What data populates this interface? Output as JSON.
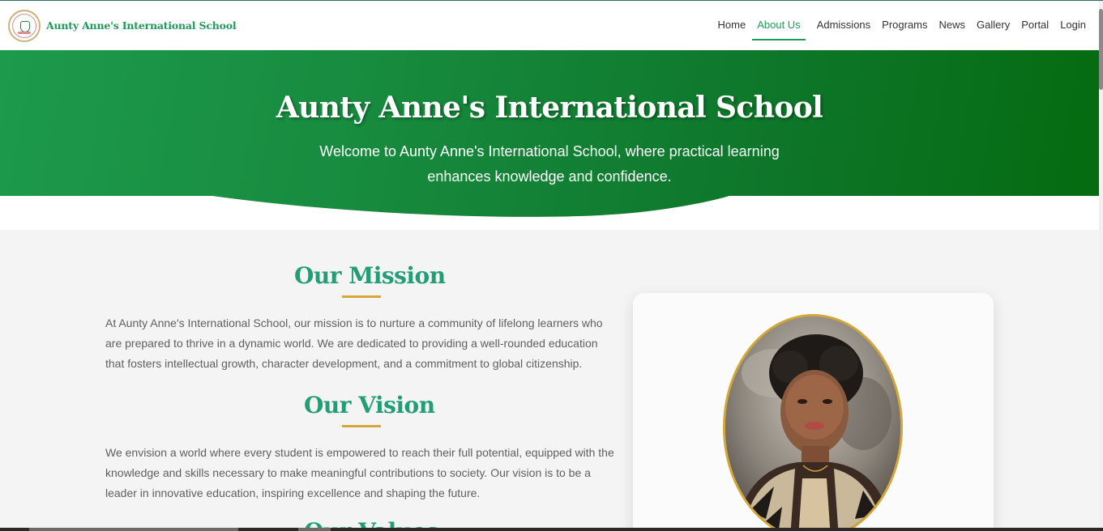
{
  "brand": {
    "name": "Aunty Anne's International School"
  },
  "nav": {
    "items": [
      {
        "label": "Home",
        "active": false
      },
      {
        "label": "About Us",
        "active": true
      },
      {
        "label": "Admissions",
        "active": false
      },
      {
        "label": "Programs",
        "active": false
      },
      {
        "label": "News",
        "active": false
      },
      {
        "label": "Gallery",
        "active": false
      },
      {
        "label": "Portal",
        "active": false
      },
      {
        "label": "Login",
        "active": false
      }
    ]
  },
  "hero": {
    "title": "Aunty Anne's International School",
    "subtitle": "Welcome to Aunty Anne's International School, where practical learning enhances knowledge and confidence."
  },
  "mission": {
    "title": "Our Mission",
    "text": "At Aunty Anne's International School, our mission is to nurture a community of lifelong learners who are prepared to thrive in a dynamic world. We are dedicated to providing a well-rounded education that fosters intellectual growth, character development, and a commitment to global citizenship."
  },
  "vision": {
    "title": "Our Vision",
    "text": "We envision a world where every student is empowered to reach their full potential, equipped with the knowledge and skills necessary to make meaningful contributions to society. Our vision is to be a leader in innovative education, inspiring excellence and shaping the future."
  },
  "values": {
    "title": "Our Values"
  },
  "colors": {
    "brand_green": "#1f9a5a",
    "heading_teal": "#239d75",
    "accent_gold": "#d4a73a",
    "hero_start": "#1d9a4c",
    "hero_end": "#056b10"
  },
  "icons": {
    "logo": "school-crest-logo",
    "portrait": "principal-portrait"
  }
}
